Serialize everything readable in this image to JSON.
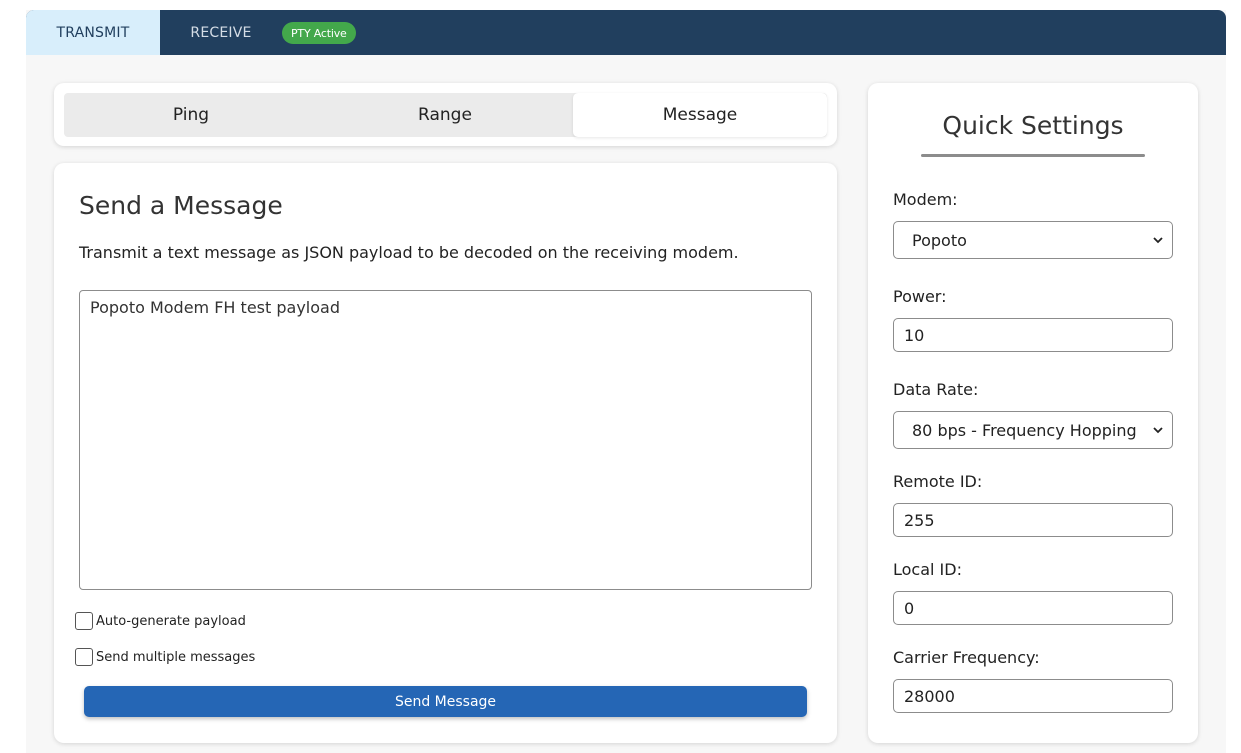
{
  "top_tabs": {
    "transmit": "TRANSMIT",
    "receive": "RECEIVE",
    "status_badge": "PTY Active"
  },
  "sub_tabs": {
    "ping": "Ping",
    "range": "Range",
    "message": "Message"
  },
  "message_panel": {
    "heading": "Send a Message",
    "description": "Transmit a text message as JSON payload to be decoded on the receiving modem.",
    "payload": "Popoto Modem FH test payload",
    "auto_generate_label": "Auto-generate payload",
    "auto_generate_checked": false,
    "send_multiple_label": "Send multiple messages",
    "send_multiple_checked": false,
    "send_button": "Send Message"
  },
  "quick_settings": {
    "title": "Quick Settings",
    "modem_label": "Modem:",
    "modem_value": "Popoto",
    "power_label": "Power:",
    "power_value": "10",
    "data_rate_label": "Data Rate:",
    "data_rate_value": "80 bps - Frequency Hopping",
    "remote_id_label": "Remote ID:",
    "remote_id_value": "255",
    "local_id_label": "Local ID:",
    "local_id_value": "0",
    "carrier_freq_label": "Carrier Frequency:",
    "carrier_freq_value": "28000"
  },
  "icons": {
    "select_arrow": "chevron-down-icon"
  },
  "colors": {
    "topbar": "#213f5e",
    "active_tab": "#d8eefb",
    "badge": "#43a84b",
    "primary_button": "#2566b5"
  }
}
